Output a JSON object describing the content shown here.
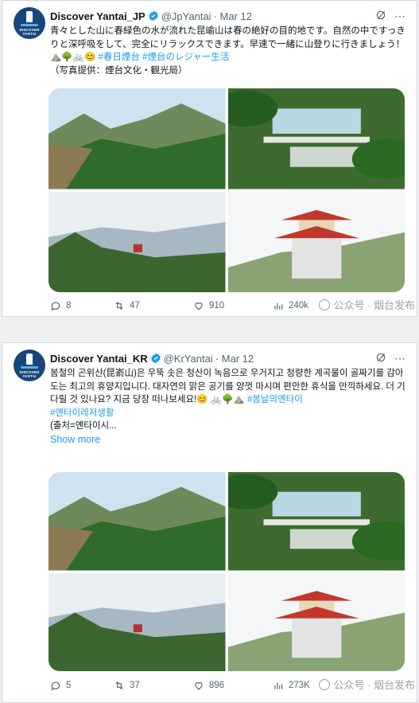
{
  "tweets": [
    {
      "account_name": "Discover Yantai_JP",
      "handle": "@JpYantai",
      "date": "· Mar 12",
      "avatar_text": "DISCOVER YANTAI",
      "text_main": "青々とした山に春緑色の水が流れた昆崳山は春の絶好の目的地です。自然の中ですっきりと深呼吸をして、完全にリラックスできます。早速で一緒に山登りに行きましょう！⛰️🌳🚲😊 ",
      "hashtag_1": "#春日煙台",
      "hashtag_2": " #煙台のレジャー生活",
      "text_credit": "（写真提供：煙台文化・観光局）",
      "show_more": "",
      "replies": "8",
      "retweets": "47",
      "likes": "910",
      "views": "240k",
      "watermark": "公众号 · 烟台发布"
    },
    {
      "account_name": "Discover Yantai_KR",
      "handle": "@KrYantai",
      "date": "· Mar 12",
      "avatar_text": "DISCOVER YANTAI",
      "text_main": "봄철의 곤위산(昆嵛山)은 우뚝 솟은 청산이 녹음으로 우거지고 청량한 계곡물이 골짜기를 감아 도는 최고의 휴양지입니다. 대자연의 맑은 공기를 양껏 마시며 편안한 휴식을 만끽하세요. 더 기다릴 것 있나요? 지금 당장 떠나보세요!😊 🚲🌳⛰️ ",
      "hashtag_1": "#봄날의옌타이",
      "hashtag_2": "#옌타이레저생활",
      "text_credit": "(출처=옌타이시...",
      "show_more": "Show more",
      "replies": "5",
      "retweets": "37",
      "likes": "896",
      "views": "273K",
      "watermark": "公众号 · 烟台发布"
    }
  ],
  "colors": {
    "link": "#1d9bf0",
    "muted": "#536471",
    "avatar_bg": "#16467a",
    "verified": "#1d9bf0"
  },
  "icons": [
    "verified-badge-icon",
    "grok-icon",
    "more-icon",
    "reply-icon",
    "retweet-icon",
    "like-icon",
    "views-icon"
  ]
}
